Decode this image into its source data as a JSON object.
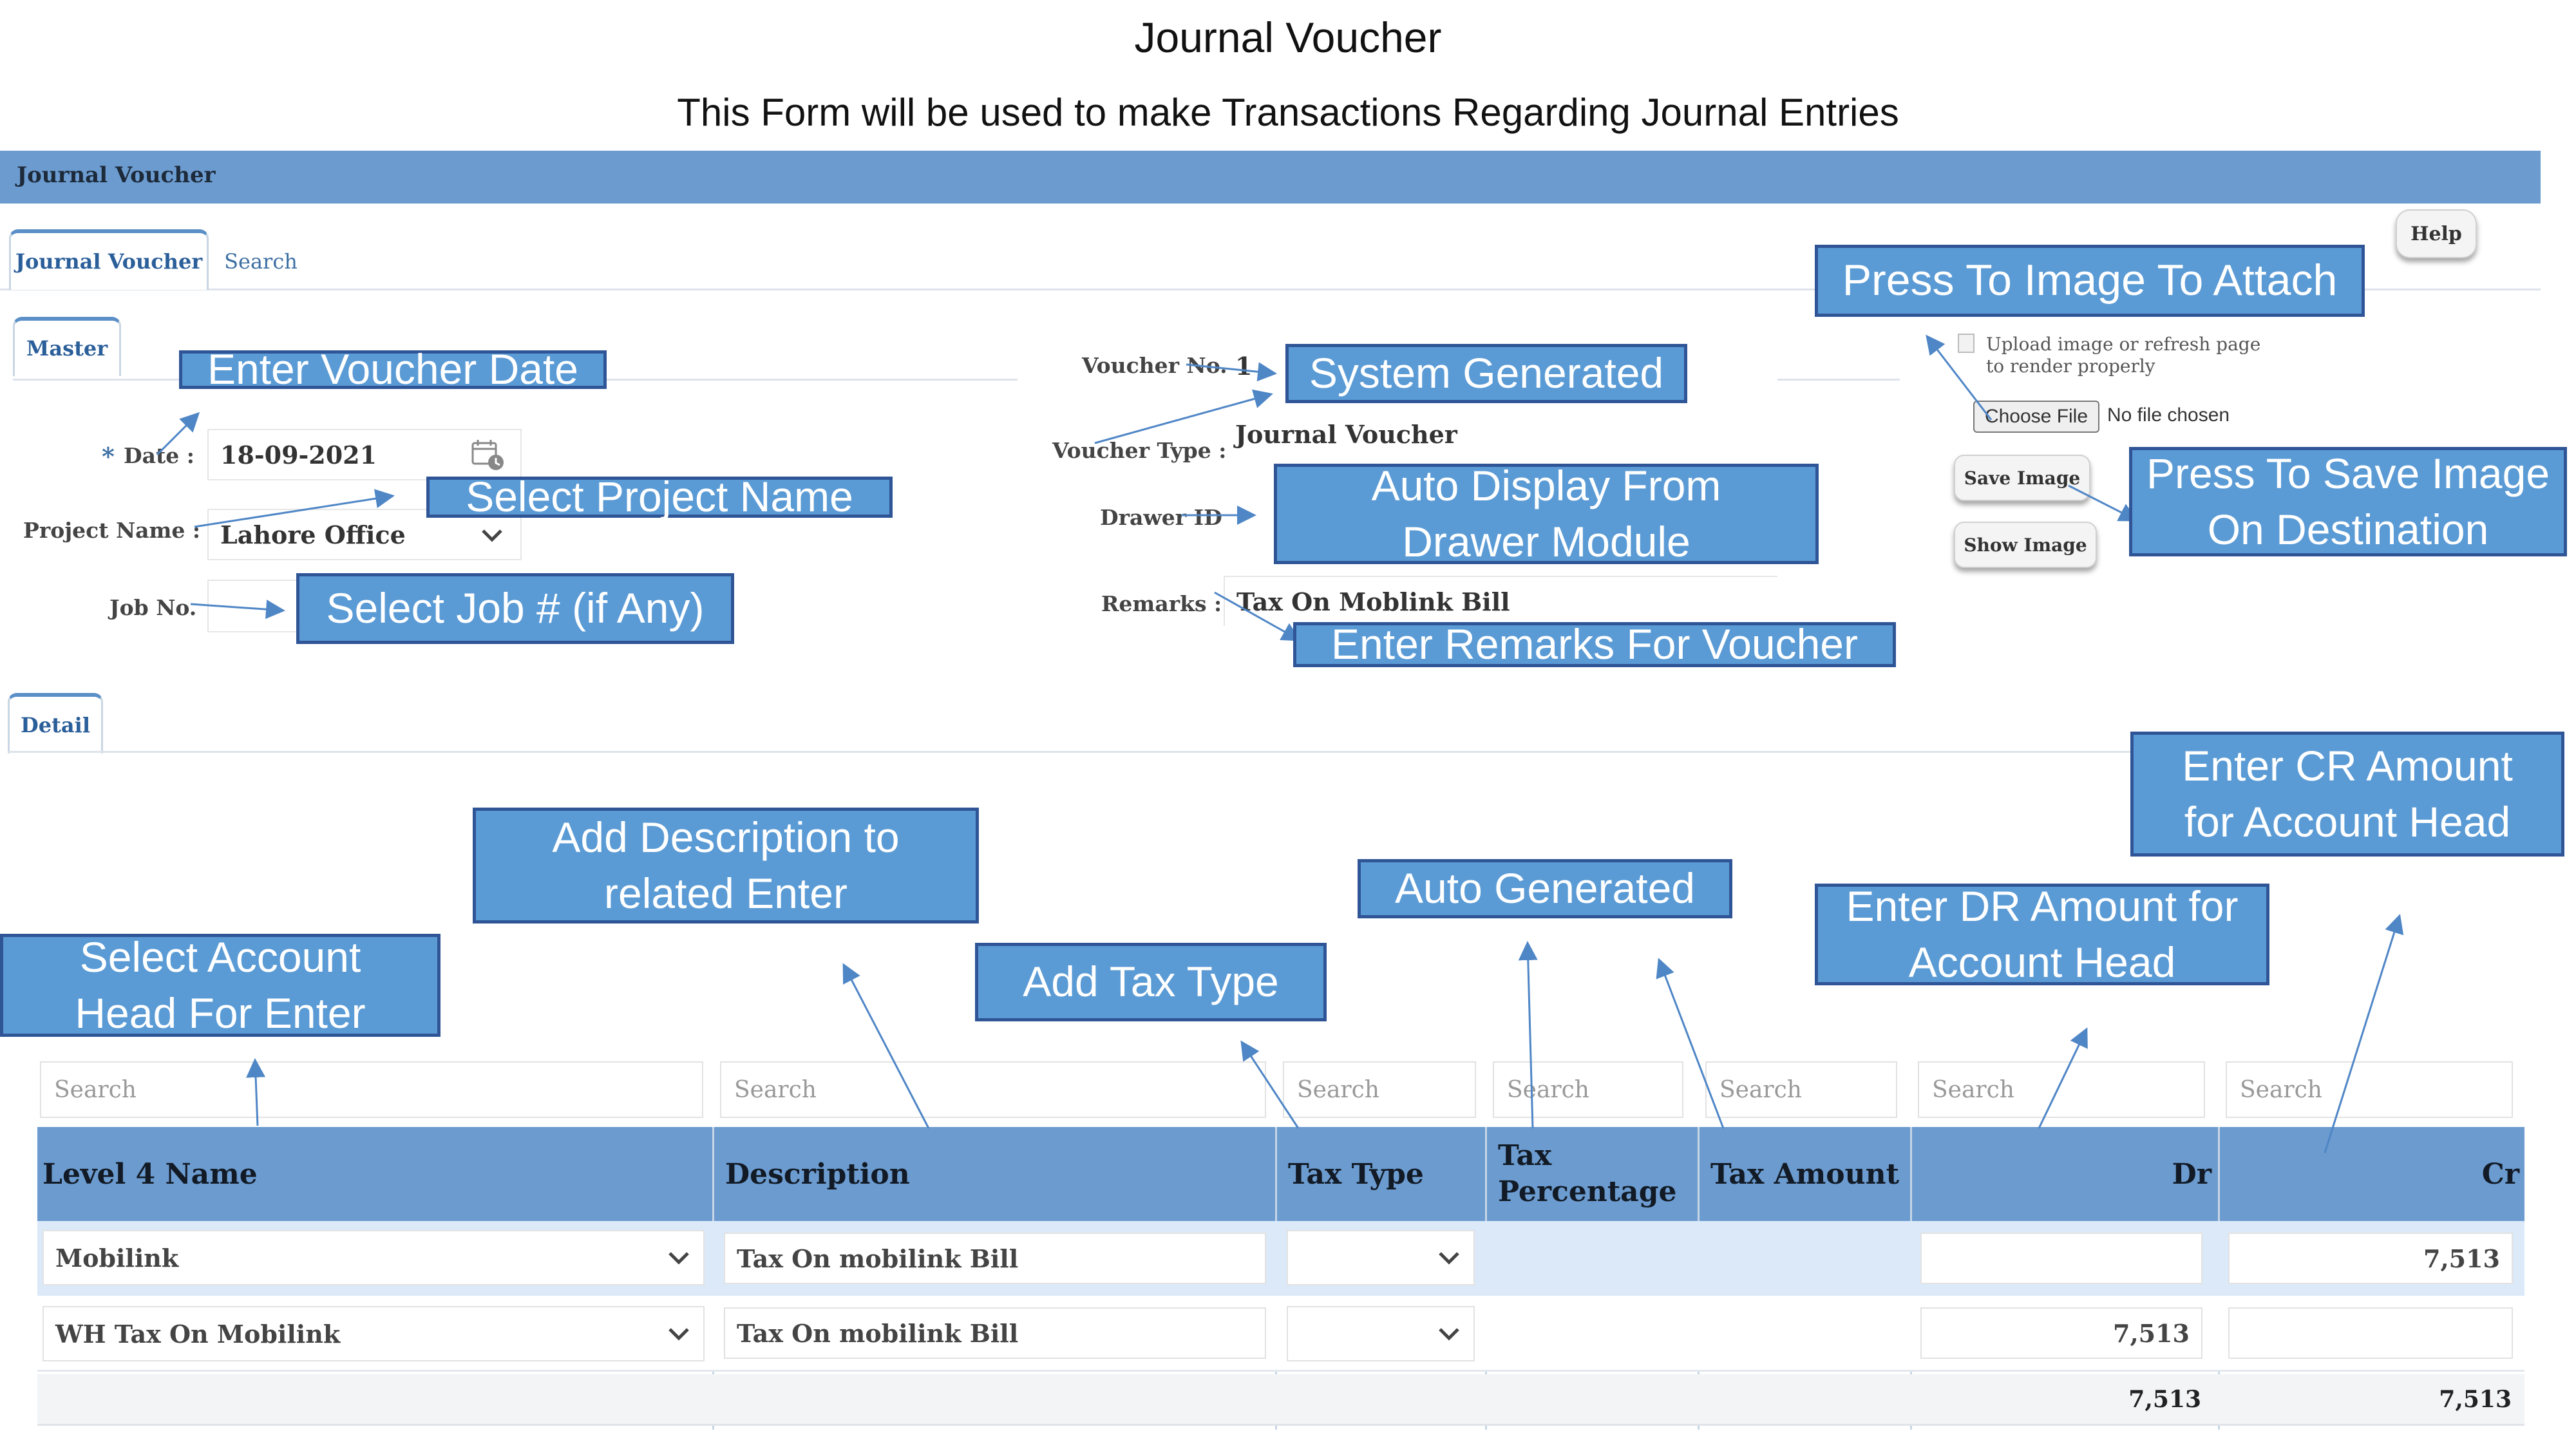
{
  "page": {
    "heading": "Journal Voucher",
    "subheading": "This Form will be used to make Transactions Regarding Journal Entries"
  },
  "titlebar": {
    "label": "Journal Voucher"
  },
  "tabs": [
    {
      "label": "Journal Voucher"
    },
    {
      "label": "Search"
    }
  ],
  "help_label": "Help",
  "master": {
    "tab_label": "Master",
    "date_label": "Date :",
    "date_value": "18-09-2021",
    "project_label": "Project Name :",
    "project_value": "Lahore Office",
    "job_label": "Job No.",
    "voucher_no_label": "Voucher No.",
    "voucher_no_value": "1",
    "voucher_type_label": "Voucher Type :",
    "voucher_type_value": "Journal Voucher",
    "drawer_label": "Drawer ID",
    "remarks_label": "Remarks :",
    "remarks_value": "Tax On Moblink Bill"
  },
  "image": {
    "alt_text": "Upload image or refresh page to render properly",
    "choose_file": "Choose File",
    "no_file": "No file chosen",
    "save_label": "Save Image",
    "show_label": "Show Image"
  },
  "detail": {
    "tab_label": "Detail",
    "search_placeholder": "Search",
    "columns": [
      "Level 4 Name",
      "Description",
      "Tax Type",
      "Tax Percentage",
      "Tax Amount",
      "Dr",
      "Cr"
    ],
    "rows": [
      {
        "account": "Mobilink",
        "description": "Tax On mobilink Bill",
        "dr": "",
        "cr": "7,513"
      },
      {
        "account": "WH Tax On Mobilink",
        "description": "Tax On mobilink Bill",
        "dr": "7,513",
        "cr": ""
      }
    ],
    "totals": {
      "dr": "7,513",
      "cr": "7,513"
    }
  },
  "annotations": {
    "voucher_date": "Enter Voucher Date",
    "project_name": "Select Project Name",
    "job_no": "Select Job # (if Any)",
    "system_generated": "System Generated",
    "drawer_line1": "Auto Display From",
    "drawer_line2": "Drawer Module",
    "remarks": "Enter Remarks For Voucher",
    "attach_image": "Press To Image To Attach",
    "save_line1": "Press To Save Image",
    "save_line2": "On Destination",
    "account_line1": "Select Account",
    "account_line2": "Head For Enter",
    "desc_line1": "Add Description to",
    "desc_line2": "related Enter",
    "tax_type": "Add Tax Type",
    "auto_generated": "Auto Generated",
    "dr_line1": "Enter DR Amount for",
    "dr_line2": "Account Head",
    "cr_line1": "Enter CR Amount",
    "cr_line2": "for Account Head"
  },
  "colors": {
    "header_blue": "#6b9bcf",
    "annotation_fill": "#5b9bd5",
    "annotation_border": "#2f5597",
    "row_highlight": "#dbe9f8"
  }
}
